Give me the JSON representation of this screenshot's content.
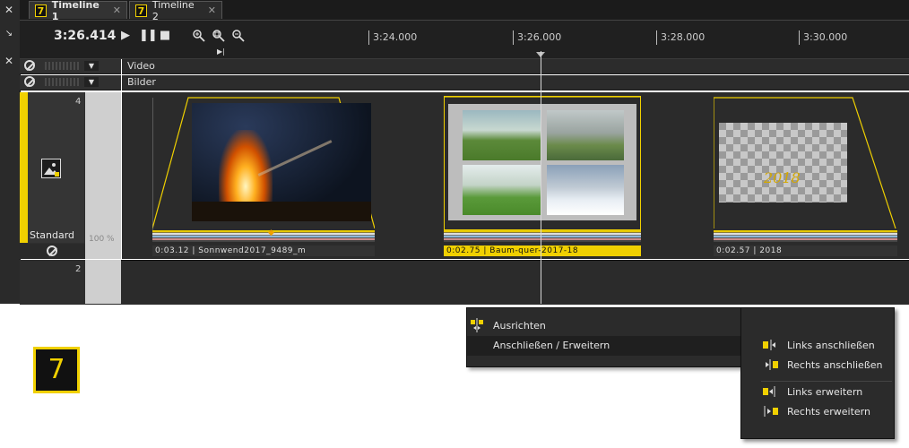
{
  "tabs": [
    {
      "num": "7",
      "label": "Timeline 1",
      "close": "✕"
    },
    {
      "num": "7",
      "label": "Timeline 2",
      "close": "✕"
    }
  ],
  "toolbar": {
    "timecode": "3:26.414",
    "ruler_labels": [
      "3:24.000",
      "3:26.000",
      "3:28.000",
      "3:30.000"
    ]
  },
  "tracks": {
    "video_label": "Video",
    "bilder_label": "Bilder",
    "main_number": "4",
    "main_name": "Standard",
    "zoom": "100 %",
    "track2_number": "2"
  },
  "clips": [
    {
      "label": "0:03.12 | Sonnwend2017_9489_m"
    },
    {
      "label": "0:02.75 | Baum-quer-2017-18"
    },
    {
      "label": "0:02.57 | 2018",
      "overlay_text": "2018"
    }
  ],
  "context_menu": {
    "items": [
      {
        "label": "Ausrichten"
      },
      {
        "label": "Anschließen / Erweitern",
        "has_submenu": true
      }
    ],
    "submenu": [
      {
        "label": "Links anschließen"
      },
      {
        "label": "Rechts anschließen"
      },
      {
        "label": "Links erweitern"
      },
      {
        "label": "Rechts erweitern"
      }
    ]
  },
  "badge": "7",
  "colors": {
    "accent": "#f0d000",
    "background": "#2b2b2b"
  }
}
